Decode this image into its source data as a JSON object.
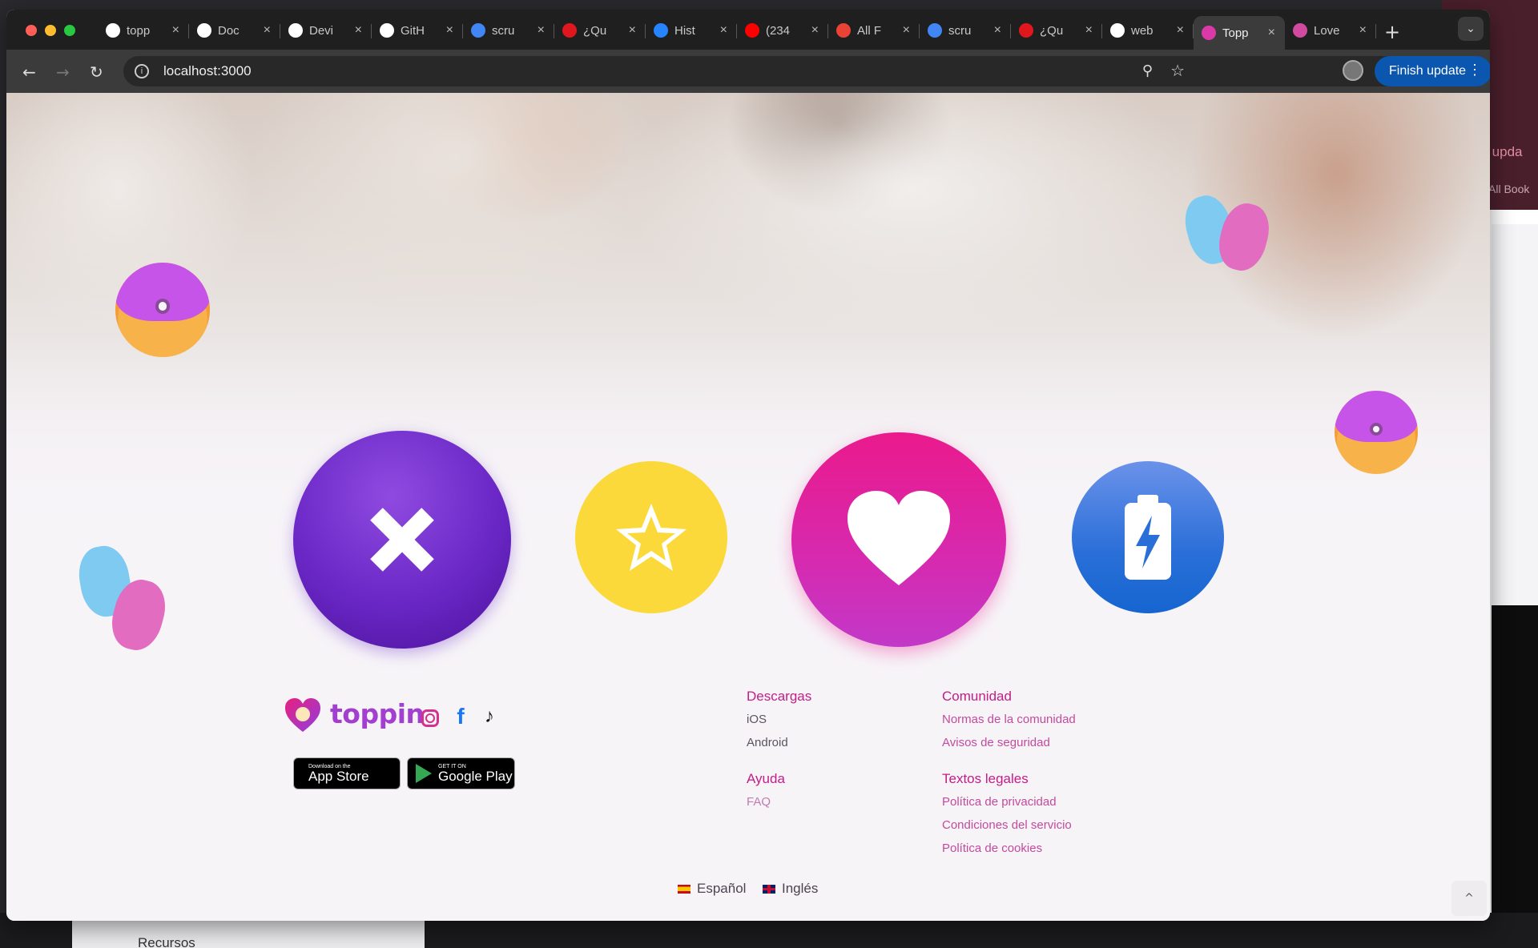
{
  "browser": {
    "tabs": [
      {
        "label": "topp",
        "icon": "github-icon",
        "color": "#ffffff"
      },
      {
        "label": "Doc",
        "icon": "openai-icon",
        "color": "#ffffff"
      },
      {
        "label": "Devi",
        "icon": "github-icon",
        "color": "#ffffff"
      },
      {
        "label": "GitH",
        "icon": "github-icon",
        "color": "#ffffff"
      },
      {
        "label": "scru",
        "icon": "google-icon",
        "color": "#4285f4"
      },
      {
        "label": "¿Qu",
        "icon": "udemy-icon",
        "color": "#e1171e"
      },
      {
        "label": "Hist",
        "icon": "atlassian-icon",
        "color": "#2684ff"
      },
      {
        "label": "(234",
        "icon": "youtube-icon",
        "color": "#ff0000"
      },
      {
        "label": "All F",
        "icon": "gmail-icon",
        "color": "#ea4335"
      },
      {
        "label": "scru",
        "icon": "google-icon",
        "color": "#4285f4"
      },
      {
        "label": "¿Qu",
        "icon": "udemy-icon",
        "color": "#e1171e"
      },
      {
        "label": "web",
        "icon": "github-icon",
        "color": "#ffffff"
      },
      {
        "label": "Topp",
        "icon": "toppin-icon",
        "color": "#d93aa8",
        "active": true
      },
      {
        "label": "Love",
        "icon": "love-icon",
        "color": "#d04aa0"
      }
    ],
    "url": "localhost:3000",
    "finish_update": "Finish update"
  },
  "background_window": {
    "finish_text": "sh upda",
    "books_text": "All Book",
    "recursos": "Recursos"
  },
  "actions": {
    "dislike": "close-icon",
    "superlike": "star-icon",
    "like": "heart-icon",
    "boost": "battery-bolt-icon"
  },
  "footer": {
    "brand": "toppin",
    "app_store_small": "Download on the",
    "app_store_big": "App Store",
    "google_play_small": "GET IT ON",
    "google_play_big": "Google Play",
    "descargas": {
      "title": "Descargas",
      "links": [
        "iOS",
        "Android"
      ]
    },
    "ayuda": {
      "title": "Ayuda",
      "links": [
        "FAQ"
      ]
    },
    "comunidad": {
      "title": "Comunidad",
      "links": [
        "Normas de la comunidad",
        "Avisos de seguridad"
      ]
    },
    "legales": {
      "title": "Textos legales",
      "links": [
        "Política de privacidad",
        "Condiciones del servicio",
        "Política de cookies"
      ]
    },
    "languages": [
      "Español",
      "Inglés"
    ],
    "scroll_top": "^"
  },
  "colors": {
    "brand_pink": "#c21d89",
    "brand_purple": "#a23fd0",
    "dislike": "#6a27c6",
    "superlike": "#fbd93a",
    "like": "#ea1a8c",
    "boost": "#2a6fd8"
  }
}
